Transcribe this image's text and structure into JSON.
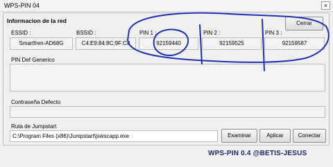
{
  "window": {
    "title": "WPS-PIN 04",
    "close_glyph": "×"
  },
  "group": {
    "title": "Informacion de la red"
  },
  "fields": {
    "essid": {
      "label": "ESSID :",
      "value": "Smartfren-AD68G"
    },
    "bssid": {
      "label": "BSSID :",
      "value": "C4:E9:84:8C:9F:C8"
    },
    "pin1": {
      "label": "PIN 1 :",
      "value": "92159440"
    },
    "pin2": {
      "label": "PIN 2 :",
      "value": "92159525"
    },
    "pin3": {
      "label": "PIN 3 :",
      "value": "92159587"
    }
  },
  "pin_def": {
    "label": "PIN Def Generico"
  },
  "password_def": {
    "label": "Contraseña Defecto"
  },
  "jumpstart": {
    "label": "Ruta de  Jumpstart",
    "value": "C:\\Program Files (x86)\\Jumpstart\\jswscapp.exe"
  },
  "buttons": {
    "cerrar": "Cerrar",
    "examinar": "Examinar",
    "aplicar": "Aplicar",
    "conectar": "Conectar"
  },
  "brand": "WPS-PIN 0.4 @BETIS-JESUS",
  "annotation_color": "#1b2fb3"
}
